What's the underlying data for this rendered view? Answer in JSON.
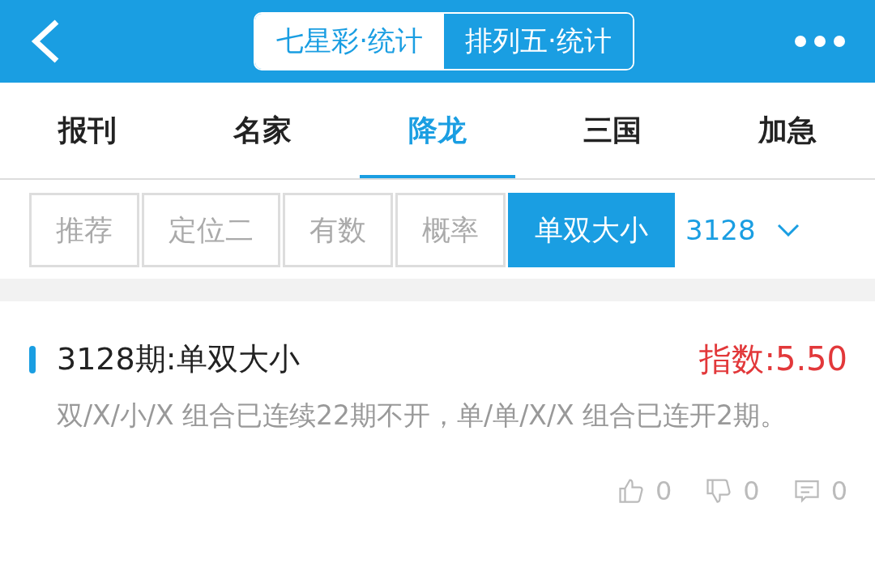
{
  "header": {
    "segments": [
      {
        "label": "七星彩·统计",
        "selected": true
      },
      {
        "label": "排列五·统计",
        "selected": false
      }
    ]
  },
  "tabs": [
    {
      "label": "报刊",
      "selected": false
    },
    {
      "label": "名家",
      "selected": false
    },
    {
      "label": "降龙",
      "selected": true
    },
    {
      "label": "三国",
      "selected": false
    },
    {
      "label": "加急",
      "selected": false
    }
  ],
  "subtabs": [
    {
      "label": "推荐",
      "selected": false
    },
    {
      "label": "定位二",
      "selected": false
    },
    {
      "label": "有数",
      "selected": false
    },
    {
      "label": "概率",
      "selected": false
    },
    {
      "label": "单双大小",
      "selected": true
    }
  ],
  "period_select": {
    "value": "3128"
  },
  "article": {
    "title": "3128期:单双大小",
    "index": "指数:5.50",
    "body": "双/X/小/X 组合已连续22期不开，单/单/X/X 组合已连开2期。",
    "actions": [
      {
        "kind": "like",
        "count": "0"
      },
      {
        "kind": "dislike",
        "count": "0"
      },
      {
        "kind": "comment",
        "count": "0"
      }
    ]
  }
}
